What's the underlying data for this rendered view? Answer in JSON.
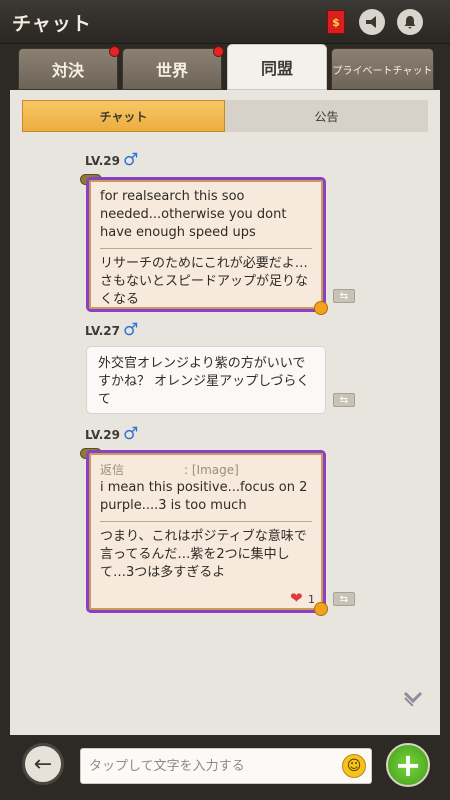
{
  "header": {
    "title": "チャット"
  },
  "tabs": [
    {
      "label": "対決",
      "has_dot": true
    },
    {
      "label": "世界",
      "has_dot": true
    },
    {
      "label": "同盟",
      "has_dot": false,
      "active": true
    },
    {
      "label": "プライベートチャット",
      "has_dot": false
    }
  ],
  "subtabs": [
    {
      "label": "チャット",
      "active": true
    },
    {
      "label": "公告",
      "active": false
    }
  ],
  "messages": [
    {
      "level": "LV.29",
      "gender": "♂",
      "original": "for realsearch this soo needed...otherwise you dont have enough speed ups",
      "translation": "リサーチのためにこれが必要だよ…さもないとスピードアップが足りなくなる"
    },
    {
      "level": "LV.27",
      "gender": "♂",
      "text": "外交官オレンジより紫の方がいいですかね？ オレンジ星アップしづらくて"
    },
    {
      "level": "LV.29",
      "gender": "♂",
      "reply_label": "返信",
      "reply_ref": ": [Image]",
      "original": "i mean this positive...focus on 2 purple....3 is too much",
      "translation": "つまり、これはポジティブな意味で言ってるんだ…紫を2つに集中して…3つは多すぎるよ",
      "likes": "1"
    }
  ],
  "input": {
    "placeholder": "タップして文字を入力する"
  },
  "icons": {
    "redpacket": "$",
    "back": "←",
    "plus": "+",
    "smile": "☺",
    "scroll": "❯❯",
    "heart": "❤",
    "translate": "⇆"
  }
}
